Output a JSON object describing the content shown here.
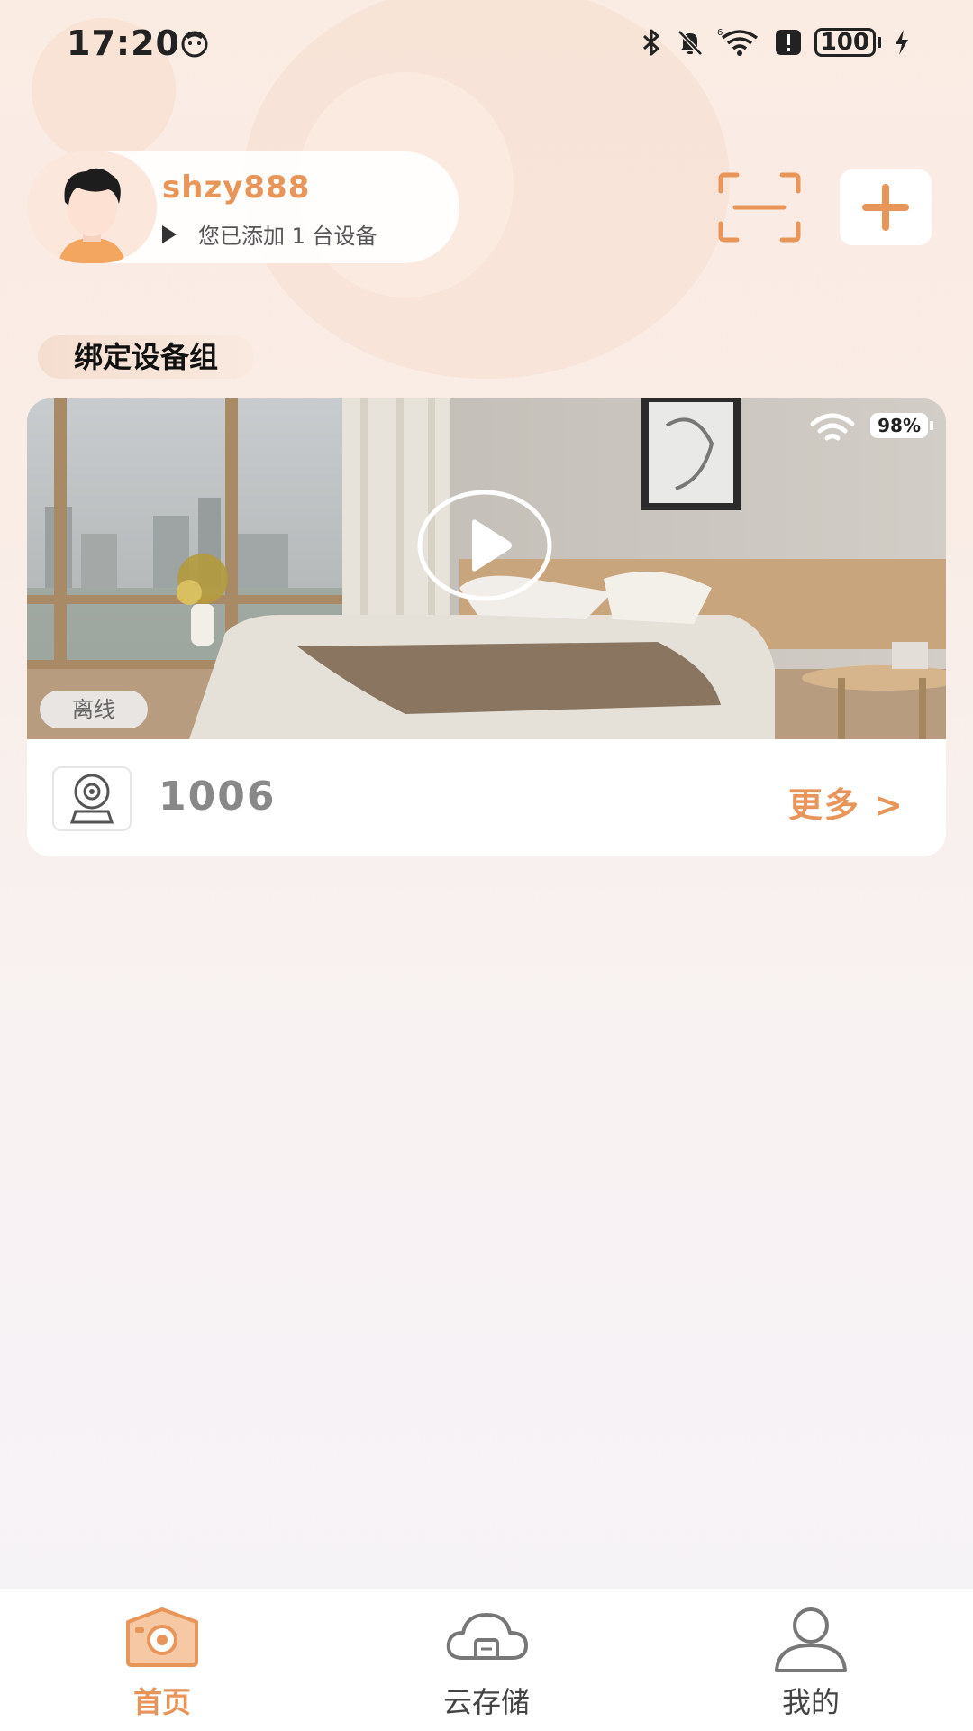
{
  "status_bar": {
    "time": "17:20",
    "battery": "100",
    "icons": [
      "smiley-icon",
      "bluetooth-icon",
      "bell-muted-icon",
      "wifi-icon",
      "alert-icon",
      "battery-icon",
      "charging-icon"
    ]
  },
  "user": {
    "username": "shzy888",
    "device_count_text": "您已添加 1 台设备",
    "avatar": "avatar-icon"
  },
  "header_actions": {
    "scan": "scan-icon",
    "add": "plus-icon"
  },
  "section": {
    "title": "绑定设备组"
  },
  "device_card": {
    "battery_percent": "98%",
    "status_badge": "离线",
    "device_name": "1006",
    "more_label": "更多 >"
  },
  "bottom_nav": {
    "items": [
      {
        "label": "首页",
        "icon": "camera-home-icon",
        "active": true
      },
      {
        "label": "云存储",
        "icon": "cloud-storage-icon",
        "active": false
      },
      {
        "label": "我的",
        "icon": "person-icon",
        "active": false
      }
    ]
  },
  "colors": {
    "accent": "#e8955a",
    "background_top": "#fbece3",
    "background_bottom": "#f6f3f8",
    "offline_badge": "#ebebeb"
  }
}
